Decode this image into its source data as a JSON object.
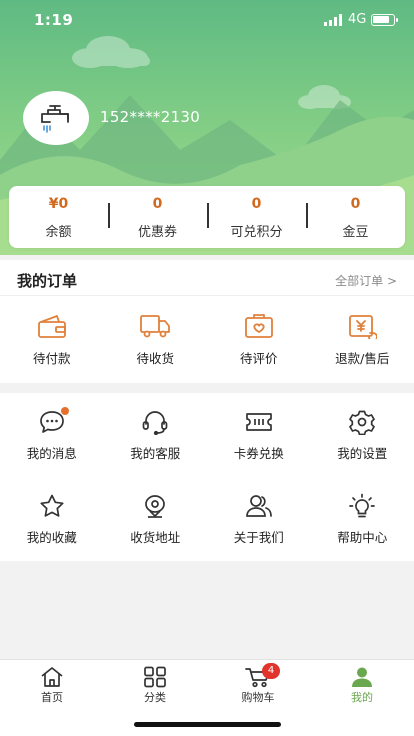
{
  "status_bar": {
    "time": "1:19",
    "network": "4G"
  },
  "profile": {
    "phone": "152****2130",
    "avatar_icon": "faucet-icon"
  },
  "assets": [
    {
      "value": "¥0",
      "label": "余额"
    },
    {
      "value": "0",
      "label": "优惠券"
    },
    {
      "value": "0",
      "label": "可兑积分"
    },
    {
      "value": "0",
      "label": "金豆"
    }
  ],
  "orders": {
    "title": "我的订单",
    "all_label": "全部订单 >",
    "items": [
      {
        "label": "待付款",
        "icon": "wallet-icon"
      },
      {
        "label": "待收货",
        "icon": "truck-icon"
      },
      {
        "label": "待评价",
        "icon": "review-icon"
      },
      {
        "label": "退款/售后",
        "icon": "refund-icon"
      }
    ]
  },
  "services": {
    "items": [
      {
        "label": "我的消息",
        "icon": "message-icon",
        "has_dot": true
      },
      {
        "label": "我的客服",
        "icon": "headset-icon"
      },
      {
        "label": "卡券兑换",
        "icon": "coupon-icon"
      },
      {
        "label": "我的设置",
        "icon": "gear-icon"
      },
      {
        "label": "我的收藏",
        "icon": "star-icon"
      },
      {
        "label": "收货地址",
        "icon": "location-icon"
      },
      {
        "label": "关于我们",
        "icon": "people-icon"
      },
      {
        "label": "帮助中心",
        "icon": "bulb-icon"
      }
    ]
  },
  "tabbar": {
    "items": [
      {
        "label": "首页",
        "icon": "home-icon"
      },
      {
        "label": "分类",
        "icon": "category-icon"
      },
      {
        "label": "购物车",
        "icon": "cart-icon",
        "badge": "4"
      },
      {
        "label": "我的",
        "icon": "user-icon",
        "active": true
      }
    ]
  },
  "colors": {
    "accent": "#6aa84f",
    "price": "#d2691e",
    "icon_orange": "#e0813a",
    "badge": "#e0342c"
  }
}
